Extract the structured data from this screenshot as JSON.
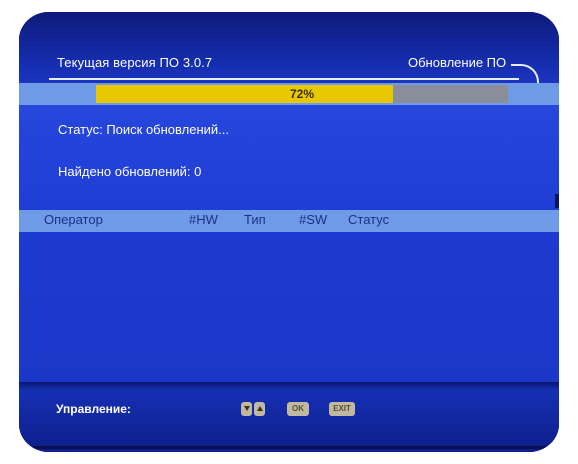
{
  "header": {
    "version_text": "Текущая версия ПО 3.0.7",
    "title": "Обновление ПО"
  },
  "progress": {
    "percent": 72,
    "label": "72%"
  },
  "status": {
    "status_text": "Статус: Поиск обновлений...",
    "found_text": "Найдено обновлений: 0"
  },
  "table": {
    "columns": [
      "Оператор",
      "#HW",
      "Тип",
      "#SW",
      "Статус"
    ],
    "rows": []
  },
  "footer": {
    "control_label": "Управление:",
    "buttons": [
      {
        "icon": "arrow-down-icon"
      },
      {
        "icon": "arrow-up-icon"
      },
      {
        "label": "OK"
      },
      {
        "label": "EXIT"
      }
    ]
  },
  "colors": {
    "background": "#1f3ed6",
    "band": "#6f9ae6",
    "progress_fill": "#e8c800",
    "progress_track": "#8a8e9a"
  }
}
